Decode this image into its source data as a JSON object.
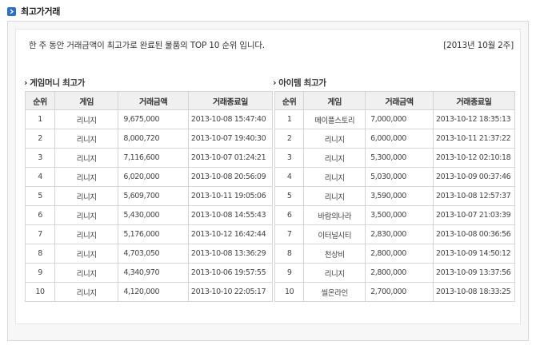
{
  "header": {
    "title": "최고가거래"
  },
  "intro": {
    "text": "한 주 동안 거래금액이 최고가로 완료된 물품의 TOP 10 순위 입니다.",
    "week": "[2013년 10월 2주]"
  },
  "game_money": {
    "title": "게임머니 최고가",
    "columns": [
      "순위",
      "게임",
      "거래금액",
      "거래종료일"
    ],
    "rows": [
      {
        "rank": "1",
        "game": "리니지",
        "amount": "9,675,000",
        "end": "2013-10-08 15:47:40"
      },
      {
        "rank": "2",
        "game": "리니지",
        "amount": "8,000,720",
        "end": "2013-10-07 19:40:30"
      },
      {
        "rank": "3",
        "game": "리니지",
        "amount": "7,116,600",
        "end": "2013-10-07 01:24:21"
      },
      {
        "rank": "4",
        "game": "리니지",
        "amount": "6,020,000",
        "end": "2013-10-08 20:56:09"
      },
      {
        "rank": "5",
        "game": "리니지",
        "amount": "5,609,700",
        "end": "2013-10-11 19:05:06"
      },
      {
        "rank": "6",
        "game": "리니지",
        "amount": "5,430,000",
        "end": "2013-10-08 14:55:43"
      },
      {
        "rank": "7",
        "game": "리니지",
        "amount": "5,176,000",
        "end": "2013-10-12 16:42:44"
      },
      {
        "rank": "8",
        "game": "리니지",
        "amount": "4,703,050",
        "end": "2013-10-08 13:36:29"
      },
      {
        "rank": "9",
        "game": "리니지",
        "amount": "4,340,970",
        "end": "2013-10-06 19:57:55"
      },
      {
        "rank": "10",
        "game": "리니지",
        "amount": "4,120,000",
        "end": "2013-10-10 22:05:17"
      }
    ]
  },
  "item": {
    "title": "아이템 최고가",
    "columns": [
      "순위",
      "게임",
      "거래금액",
      "거래종료일"
    ],
    "rows": [
      {
        "rank": "1",
        "game": "메이플스토리",
        "amount": "7,000,000",
        "end": "2013-10-12 18:35:13"
      },
      {
        "rank": "2",
        "game": "리니지",
        "amount": "6,000,000",
        "end": "2013-10-11 21:37:22"
      },
      {
        "rank": "3",
        "game": "리니지",
        "amount": "5,300,000",
        "end": "2013-10-12 02:10:18"
      },
      {
        "rank": "4",
        "game": "리니지",
        "amount": "5,030,000",
        "end": "2013-10-09 00:37:46"
      },
      {
        "rank": "5",
        "game": "리니지",
        "amount": "3,590,000",
        "end": "2013-10-08 12:57:37"
      },
      {
        "rank": "6",
        "game": "바람의나라",
        "amount": "3,500,000",
        "end": "2013-10-07 21:03:39"
      },
      {
        "rank": "7",
        "game": "이터널시티",
        "amount": "2,830,000",
        "end": "2013-10-08 00:36:56"
      },
      {
        "rank": "8",
        "game": "천상비",
        "amount": "2,800,000",
        "end": "2013-10-09 14:50:12"
      },
      {
        "rank": "9",
        "game": "리니지",
        "amount": "2,800,000",
        "end": "2013-10-09 13:37:56"
      },
      {
        "rank": "10",
        "game": "씰온라인",
        "amount": "2,700,000",
        "end": "2013-10-08 18:33:25"
      }
    ]
  },
  "colors": {
    "accent": "#2a6fc9",
    "border": "#d4d4d4",
    "header_bg": "#f0f0f0"
  }
}
